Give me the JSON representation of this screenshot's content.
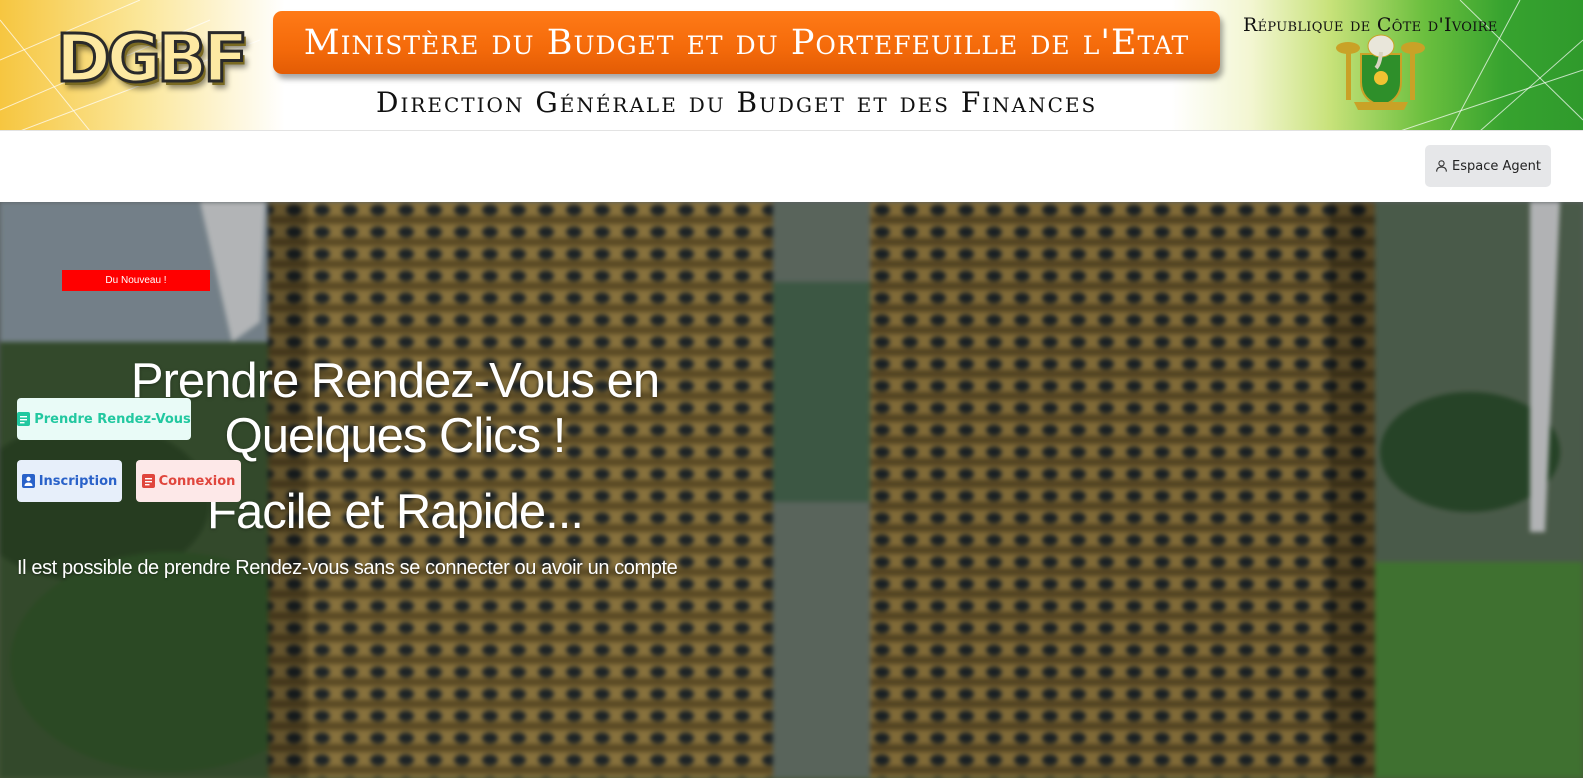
{
  "banner": {
    "logo_text": "DGBF",
    "ministry": "Ministère du Budget et du Portefeuille de l'Etat",
    "direction": "Direction Générale du Budget et des Finances",
    "republic": "République de Côte d'Ivoire"
  },
  "nav": {
    "agent_button": "Espace Agent",
    "agent_icon": "user-icon"
  },
  "hero": {
    "badge": "Du Nouveau !",
    "title": "Prendre Rendez-Vous en Quelques Clics !",
    "subtitle": "Facile et Rapide...",
    "info": "Il est possible de prendre Rendez-vous sans se connecter ou avoir un compte",
    "buttons": {
      "appointment": "Prendre Rendez-Vous",
      "register": "Inscription",
      "login": "Connexion"
    }
  },
  "colors": {
    "orange": "#f46a0a",
    "badge_red": "#ff0000",
    "teal": "#22c8a0",
    "blue": "#2a62c9",
    "red": "#e0463d"
  }
}
